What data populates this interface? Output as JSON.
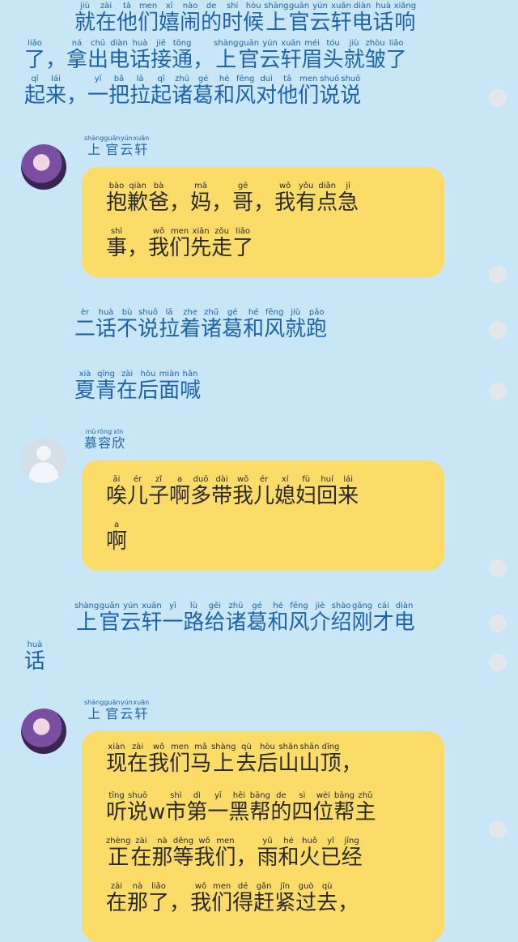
{
  "narration1": {
    "lines": [
      [
        [
          "就",
          "jiù"
        ],
        [
          "在",
          "zài"
        ],
        [
          "他",
          "tā"
        ],
        [
          "们",
          "men"
        ],
        [
          "嬉",
          "xī"
        ],
        [
          "闹",
          "nào"
        ],
        [
          "的",
          "de"
        ],
        [
          "时",
          "shí"
        ],
        [
          "候",
          "hòu"
        ],
        [
          "上",
          "shàng"
        ],
        [
          "官",
          "guān"
        ],
        [
          "云",
          "yún"
        ],
        [
          "轩",
          "xuān"
        ],
        [
          "电",
          "diàn"
        ],
        [
          "话",
          "huà"
        ],
        [
          "响",
          "xiǎng"
        ]
      ],
      [
        [
          "了",
          "liǎo"
        ],
        [
          "，",
          ""
        ],
        [
          "拿",
          "ná"
        ],
        [
          "出",
          "chū"
        ],
        [
          "电",
          "diàn"
        ],
        [
          "话",
          "huà"
        ],
        [
          "接",
          "jiē"
        ],
        [
          "通",
          "tōng"
        ],
        [
          "，",
          ""
        ],
        [
          "上",
          "shàng"
        ],
        [
          "官",
          "guān"
        ],
        [
          "云",
          "yún"
        ],
        [
          "轩",
          "xuān"
        ],
        [
          "眉",
          "méi"
        ],
        [
          "头",
          "tóu"
        ],
        [
          "就",
          "jiù"
        ],
        [
          "皱",
          "zhòu"
        ],
        [
          "了",
          "liǎo"
        ]
      ],
      [
        [
          "起",
          "qǐ"
        ],
        [
          "来",
          "lái"
        ],
        [
          "，",
          ""
        ],
        [
          "一",
          "yī"
        ],
        [
          "把",
          "bǎ"
        ],
        [
          "拉",
          "lā"
        ],
        [
          "起",
          "qǐ"
        ],
        [
          "诸",
          "zhū"
        ],
        [
          "葛",
          "gé"
        ],
        [
          "和",
          "hé"
        ],
        [
          "风",
          "fēng"
        ],
        [
          "对",
          "duì"
        ],
        [
          "他",
          "tā"
        ],
        [
          "们",
          "men"
        ],
        [
          "说",
          "shuō"
        ],
        [
          "说",
          "shuō"
        ]
      ]
    ]
  },
  "message1": {
    "speaker": [
      [
        "上",
        "shàng"
      ],
      [
        "官",
        "guān"
      ],
      [
        "云",
        "yún"
      ],
      [
        "轩",
        "xuān"
      ]
    ],
    "lines": [
      [
        [
          "抱",
          "bào"
        ],
        [
          "歉",
          "qiàn"
        ],
        [
          "爸",
          "bà"
        ],
        [
          "，",
          ""
        ],
        [
          "妈",
          "mā"
        ],
        [
          "，",
          ""
        ],
        [
          "哥",
          "gē"
        ],
        [
          "，",
          ""
        ],
        [
          "我",
          "wǒ"
        ],
        [
          "有",
          "yǒu"
        ],
        [
          "点",
          "diǎn"
        ],
        [
          "急",
          "jí"
        ]
      ],
      [
        [
          "事",
          "shì"
        ],
        [
          "，",
          ""
        ],
        [
          "我",
          "wǒ"
        ],
        [
          "们",
          "men"
        ],
        [
          "先",
          "xiān"
        ],
        [
          "走",
          "zǒu"
        ],
        [
          "了",
          "liǎo"
        ]
      ]
    ]
  },
  "narration2": {
    "lines": [
      [
        [
          "二",
          "èr"
        ],
        [
          "话",
          "huà"
        ],
        [
          "不",
          "bù"
        ],
        [
          "说",
          "shuō"
        ],
        [
          "拉",
          "lā"
        ],
        [
          "着",
          "zhe"
        ],
        [
          "诸",
          "zhū"
        ],
        [
          "葛",
          "gé"
        ],
        [
          "和",
          "hé"
        ],
        [
          "风",
          "fēng"
        ],
        [
          "就",
          "jiù"
        ],
        [
          "跑",
          "pǎo"
        ]
      ]
    ]
  },
  "narration3": {
    "lines": [
      [
        [
          "夏",
          "xià"
        ],
        [
          "青",
          "qīng"
        ],
        [
          "在",
          "zài"
        ],
        [
          "后",
          "hòu"
        ],
        [
          "面",
          "miàn"
        ],
        [
          "喊",
          "hǎn"
        ]
      ]
    ]
  },
  "message2": {
    "speaker": [
      [
        "慕",
        "mù"
      ],
      [
        "容",
        "róng"
      ],
      [
        "欣",
        "xīn"
      ]
    ],
    "lines": [
      [
        [
          "唉",
          "āi"
        ],
        [
          "儿",
          "ér"
        ],
        [
          "子",
          "zǐ"
        ],
        [
          "啊",
          "a"
        ],
        [
          "多",
          "duō"
        ],
        [
          "带",
          "dài"
        ],
        [
          "我",
          "wǒ"
        ],
        [
          "儿",
          "ér"
        ],
        [
          "媳",
          "xí"
        ],
        [
          "妇",
          "fù"
        ],
        [
          "回",
          "huí"
        ],
        [
          "来",
          "lái"
        ]
      ],
      [
        [
          "啊",
          "a"
        ]
      ]
    ]
  },
  "narration4": {
    "lines": [
      [
        [
          "上",
          "shàng"
        ],
        [
          "官",
          "guān"
        ],
        [
          "云",
          "yún"
        ],
        [
          "轩",
          "xuān"
        ],
        [
          "一",
          "yī"
        ],
        [
          "路",
          "lù"
        ],
        [
          "给",
          "gěi"
        ],
        [
          "诸",
          "zhū"
        ],
        [
          "葛",
          "gé"
        ],
        [
          "和",
          "hé"
        ],
        [
          "风",
          "fēng"
        ],
        [
          "介",
          "jiè"
        ],
        [
          "绍",
          "shào"
        ],
        [
          "刚",
          "gāng"
        ],
        [
          "才",
          "cái"
        ],
        [
          "电",
          "diàn"
        ]
      ],
      [
        [
          "话",
          "huà"
        ]
      ]
    ]
  },
  "message3": {
    "speaker": [
      [
        "上",
        "shàng"
      ],
      [
        "官",
        "guān"
      ],
      [
        "云",
        "yún"
      ],
      [
        "轩",
        "xuān"
      ]
    ],
    "lines": [
      [
        [
          "现",
          "xiàn"
        ],
        [
          "在",
          "zài"
        ],
        [
          "我",
          "wǒ"
        ],
        [
          "们",
          "men"
        ],
        [
          "马",
          "mǎ"
        ],
        [
          "上",
          "shàng"
        ],
        [
          "去",
          "qù"
        ],
        [
          "后",
          "hòu"
        ],
        [
          "山",
          "shān"
        ],
        [
          "山",
          "shān"
        ],
        [
          "顶",
          "dǐng"
        ],
        [
          "，",
          ""
        ]
      ],
      [
        [
          "听",
          "tīng"
        ],
        [
          "说",
          "shuō"
        ],
        [
          "w",
          ""
        ],
        [
          "市",
          "shì"
        ],
        [
          "第",
          "dì"
        ],
        [
          "一",
          "yī"
        ],
        [
          "黑",
          "hēi"
        ],
        [
          "帮",
          "bāng"
        ],
        [
          "的",
          "de"
        ],
        [
          "四",
          "sì"
        ],
        [
          "位",
          "wèi"
        ],
        [
          "帮",
          "bāng"
        ],
        [
          "主",
          "zhǔ"
        ]
      ],
      [
        [
          "正",
          "zhèng"
        ],
        [
          "在",
          "zài"
        ],
        [
          "那",
          "nà"
        ],
        [
          "等",
          "děng"
        ],
        [
          "我",
          "wǒ"
        ],
        [
          "们",
          "men"
        ],
        [
          "，",
          ""
        ],
        [
          "雨",
          "yǔ"
        ],
        [
          "和",
          "hé"
        ],
        [
          "火",
          "huǒ"
        ],
        [
          "已",
          "yǐ"
        ],
        [
          "经",
          "jīng"
        ]
      ],
      [
        [
          "在",
          "zài"
        ],
        [
          "那",
          "nà"
        ],
        [
          "了",
          "liǎo"
        ],
        [
          "，",
          ""
        ],
        [
          "我",
          "wǒ"
        ],
        [
          "们",
          "men"
        ],
        [
          "得",
          "dé"
        ],
        [
          "赶",
          "gǎn"
        ],
        [
          "紧",
          "jǐn"
        ],
        [
          "过",
          "guò"
        ],
        [
          "去",
          "qù"
        ],
        [
          "，",
          ""
        ]
      ]
    ]
  }
}
